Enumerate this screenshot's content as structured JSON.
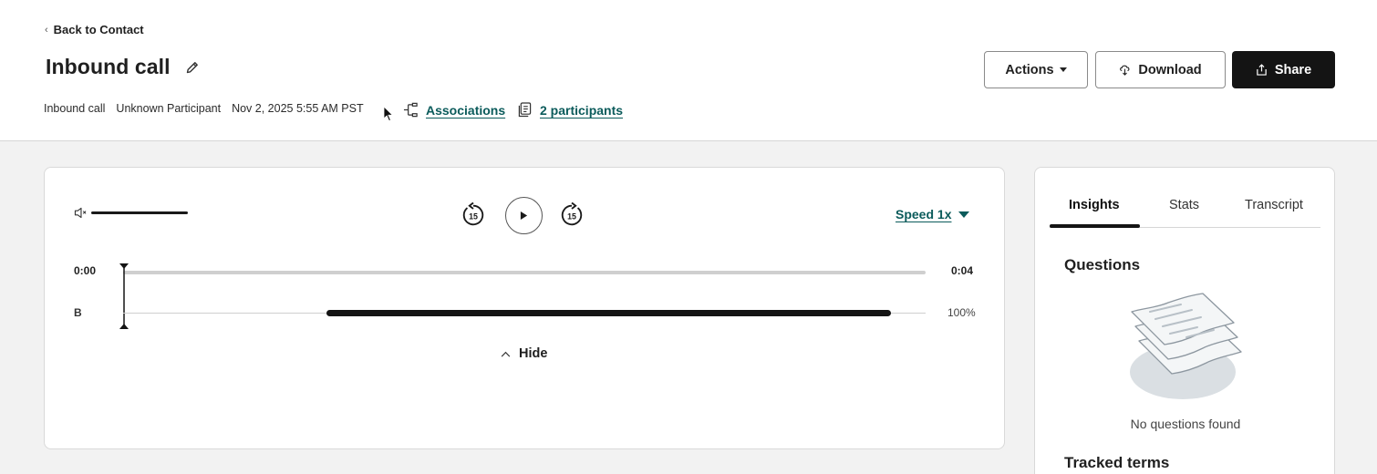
{
  "back_link": "Back to Contact",
  "title": "Inbound call",
  "meta": {
    "type": "Inbound call",
    "participant": "Unknown Participant",
    "datetime": "Nov 2, 2025 5:55 AM PST",
    "associations": "Associations",
    "participants": "2 participants"
  },
  "actions": {
    "actions_label": "Actions",
    "download_label": "Download",
    "share_label": "Share"
  },
  "player": {
    "skip_seconds": "15",
    "speed_label": "Speed 1x",
    "time_start": "0:00",
    "time_end": "0:04",
    "speaker_label": "B",
    "speaker_percent": "100%",
    "hide_label": "Hide"
  },
  "sidebar": {
    "tabs": [
      {
        "label": "Insights",
        "active": true
      },
      {
        "label": "Stats",
        "active": false
      },
      {
        "label": "Transcript",
        "active": false
      }
    ],
    "questions_heading": "Questions",
    "empty_text": "No questions found",
    "tracked_terms_heading": "Tracked terms"
  },
  "colors": {
    "link": "#0b5b5b",
    "primary_button": "#141414"
  }
}
